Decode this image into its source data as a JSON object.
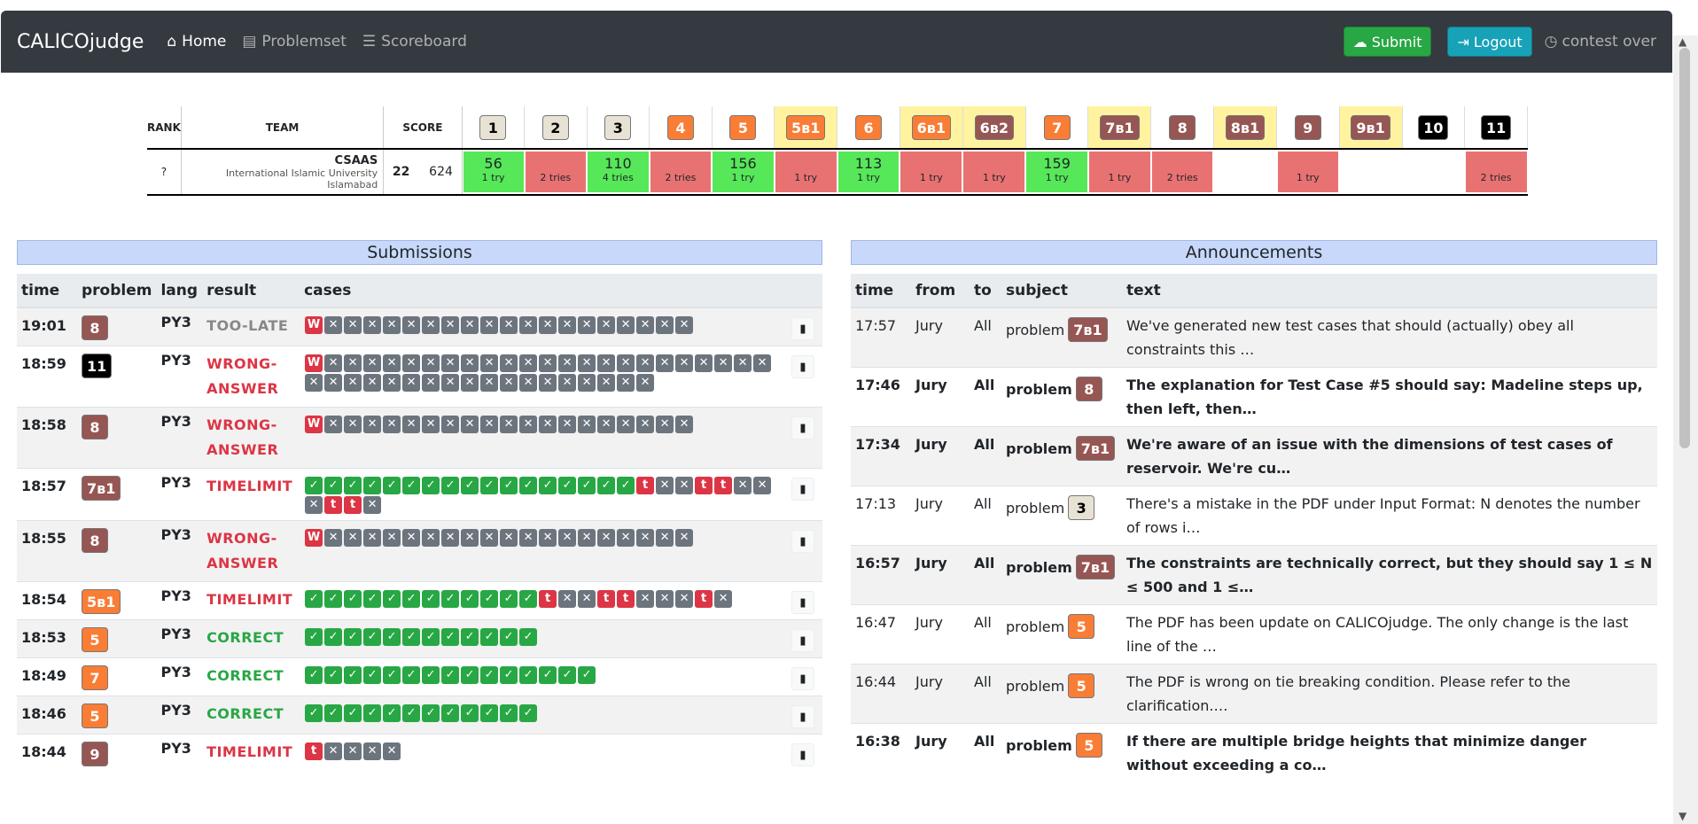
{
  "navbar": {
    "brand": "CALICOjudge",
    "links": [
      {
        "label": "Home",
        "icon": "home-icon",
        "active": true
      },
      {
        "label": "Problemset",
        "icon": "book-icon",
        "active": false
      },
      {
        "label": "Scoreboard",
        "icon": "list-icon",
        "active": false
      }
    ],
    "submit_label": "Submit",
    "logout_label": "Logout",
    "status": "contest over"
  },
  "scoreboard": {
    "headers": {
      "rank": "RANK",
      "team": "TEAM",
      "score": "SCORE"
    },
    "problems": [
      {
        "label": "1",
        "bg": "#e8e2d5",
        "fg": "#000",
        "hl": false
      },
      {
        "label": "2",
        "bg": "#e8e2d5",
        "fg": "#000",
        "hl": false
      },
      {
        "label": "3",
        "bg": "#e8e2d5",
        "fg": "#000",
        "hl": false
      },
      {
        "label": "4",
        "bg": "#f97d35",
        "fg": "#fff",
        "hl": false
      },
      {
        "label": "5",
        "bg": "#f97d35",
        "fg": "#fff",
        "hl": false
      },
      {
        "label": "5в1",
        "bg": "#f97d35",
        "fg": "#fff",
        "hl": true
      },
      {
        "label": "6",
        "bg": "#f97d35",
        "fg": "#fff",
        "hl": false
      },
      {
        "label": "6в1",
        "bg": "#f97d35",
        "fg": "#fff",
        "hl": true
      },
      {
        "label": "6в2",
        "bg": "#965653",
        "fg": "#fff",
        "hl": true
      },
      {
        "label": "7",
        "bg": "#f97d35",
        "fg": "#fff",
        "hl": false
      },
      {
        "label": "7в1",
        "bg": "#965653",
        "fg": "#fff",
        "hl": true
      },
      {
        "label": "8",
        "bg": "#965653",
        "fg": "#fff",
        "hl": false
      },
      {
        "label": "8в1",
        "bg": "#965653",
        "fg": "#fff",
        "hl": true
      },
      {
        "label": "9",
        "bg": "#965653",
        "fg": "#fff",
        "hl": false
      },
      {
        "label": "9в1",
        "bg": "#965653",
        "fg": "#fff",
        "hl": true
      },
      {
        "label": "10",
        "bg": "#000000",
        "fg": "#fff",
        "hl": false
      },
      {
        "label": "11",
        "bg": "#000000",
        "fg": "#fff",
        "hl": false
      }
    ],
    "row": {
      "rank": "?",
      "team_name": "CSAAS",
      "affiliation": "International Islamic University Islamabad",
      "solved": "22",
      "penalty": "624",
      "cells": [
        {
          "status": "solved",
          "time": "56",
          "tries": "1 try"
        },
        {
          "status": "fail",
          "time": "",
          "tries": "2 tries"
        },
        {
          "status": "solved",
          "time": "110",
          "tries": "4 tries"
        },
        {
          "status": "fail",
          "time": "",
          "tries": "2 tries"
        },
        {
          "status": "solved",
          "time": "156",
          "tries": "1 try"
        },
        {
          "status": "fail",
          "time": "",
          "tries": "1 try"
        },
        {
          "status": "solved",
          "time": "113",
          "tries": "1 try"
        },
        {
          "status": "fail",
          "time": "",
          "tries": "1 try"
        },
        {
          "status": "fail",
          "time": "",
          "tries": "1 try"
        },
        {
          "status": "solved",
          "time": "159",
          "tries": "1 try"
        },
        {
          "status": "fail",
          "time": "",
          "tries": "1 try"
        },
        {
          "status": "fail",
          "time": "",
          "tries": "2 tries"
        },
        {
          "status": "empty",
          "time": "",
          "tries": ""
        },
        {
          "status": "fail",
          "time": "",
          "tries": "1 try"
        },
        {
          "status": "empty",
          "time": "",
          "tries": ""
        },
        {
          "status": "empty",
          "time": "",
          "tries": ""
        },
        {
          "status": "fail",
          "time": "",
          "tries": "2 tries"
        }
      ]
    }
  },
  "submissions": {
    "title": "Submissions",
    "headers": [
      "time",
      "problem",
      "lang",
      "result",
      "cases"
    ],
    "rows": [
      {
        "time": "19:01",
        "problem": "8",
        "pbg": "#965653",
        "pfg": "#fff",
        "lang": "PY3",
        "result": "TOO-LATE",
        "rclass": "r-late",
        "cases": "WXXXXXXXXXXXXXXXXXXX"
      },
      {
        "time": "18:59",
        "problem": "11",
        "pbg": "#000000",
        "pfg": "#fff",
        "lang": "PY3",
        "result": "WRONG-ANSWER",
        "rclass": "r-wrong",
        "cases": "WXXXXXXXXXXXXXXXXXXXXXXXXXXXXXXXXXXXXXXXXX"
      },
      {
        "time": "18:58",
        "problem": "8",
        "pbg": "#965653",
        "pfg": "#fff",
        "lang": "PY3",
        "result": "WRONG-ANSWER",
        "rclass": "r-wrong",
        "cases": "WXXXXXXXXXXXXXXXXXXX"
      },
      {
        "time": "18:57",
        "problem": "7в1",
        "pbg": "#965653",
        "pfg": "#fff",
        "lang": "PY3",
        "result": "TIMELIMIT",
        "rclass": "r-time",
        "cases": "VVVVVVVVVVVVVVVVVTXXTTXXXTTX"
      },
      {
        "time": "18:55",
        "problem": "8",
        "pbg": "#965653",
        "pfg": "#fff",
        "lang": "PY3",
        "result": "WRONG-ANSWER",
        "rclass": "r-wrong",
        "cases": "WXXXXXXXXXXXXXXXXXXX"
      },
      {
        "time": "18:54",
        "problem": "5в1",
        "pbg": "#f97d35",
        "pfg": "#fff",
        "lang": "PY3",
        "result": "TIMELIMIT",
        "rclass": "r-time",
        "cases": "VVVVVVVVVVVVTXXTTXXXTX"
      },
      {
        "time": "18:53",
        "problem": "5",
        "pbg": "#f97d35",
        "pfg": "#fff",
        "lang": "PY3",
        "result": "CORRECT",
        "rclass": "r-correct",
        "cases": "VVVVVVVVVVVV"
      },
      {
        "time": "18:49",
        "problem": "7",
        "pbg": "#f97d35",
        "pfg": "#fff",
        "lang": "PY3",
        "result": "CORRECT",
        "rclass": "r-correct",
        "cases": "VVVVVVVVVVVVVVV"
      },
      {
        "time": "18:46",
        "problem": "5",
        "pbg": "#f97d35",
        "pfg": "#fff",
        "lang": "PY3",
        "result": "CORRECT",
        "rclass": "r-correct",
        "cases": "VVVVVVVVVVVV"
      },
      {
        "time": "18:44",
        "problem": "9",
        "pbg": "#965653",
        "pfg": "#fff",
        "lang": "PY3",
        "result": "TIMELIMIT",
        "rclass": "r-time",
        "cases": "TXXXX"
      }
    ]
  },
  "announcements": {
    "title": "Announcements",
    "headers": [
      "time",
      "from",
      "to",
      "subject",
      "text"
    ],
    "rows": [
      {
        "time": "17:57",
        "from": "Jury",
        "to": "All",
        "subject": "problem",
        "problem": "7в1",
        "pbg": "#965653",
        "pfg": "#fff",
        "text": "We've generated new test cases that should (actually) obey all constraints this …",
        "bold": false
      },
      {
        "time": "17:46",
        "from": "Jury",
        "to": "All",
        "subject": "problem",
        "problem": "8",
        "pbg": "#965653",
        "pfg": "#fff",
        "text": "The explanation for Test Case #5 should say: Madeline steps up, then left, then…",
        "bold": true
      },
      {
        "time": "17:34",
        "from": "Jury",
        "to": "All",
        "subject": "problem",
        "problem": "7в1",
        "pbg": "#965653",
        "pfg": "#fff",
        "text": "We're aware of an issue with the dimensions of test cases of reservoir. We're cu…",
        "bold": true
      },
      {
        "time": "17:13",
        "from": "Jury",
        "to": "All",
        "subject": "problem",
        "problem": "3",
        "pbg": "#e8e2d5",
        "pfg": "#000",
        "text": "There's a mistake in the PDF under Input Format: N denotes the number of rows i…",
        "bold": false
      },
      {
        "time": "16:57",
        "from": "Jury",
        "to": "All",
        "subject": "problem",
        "problem": "7в1",
        "pbg": "#965653",
        "pfg": "#fff",
        "text": "The constraints are technically correct, but they should say 1 ≤ N ≤ 500 and 1 ≤…",
        "bold": true
      },
      {
        "time": "16:47",
        "from": "Jury",
        "to": "All",
        "subject": "problem",
        "problem": "5",
        "pbg": "#f97d35",
        "pfg": "#fff",
        "text": "The PDF has been update on CALICOjudge. The only change is the last line of the …",
        "bold": false
      },
      {
        "time": "16:44",
        "from": "Jury",
        "to": "All",
        "subject": "problem",
        "problem": "5",
        "pbg": "#f97d35",
        "pfg": "#fff",
        "text": "The PDF is wrong on tie breaking condition. Please refer to the clarification.…",
        "bold": false
      },
      {
        "time": "16:38",
        "from": "Jury",
        "to": "All",
        "subject": "problem",
        "problem": "5",
        "pbg": "#f97d35",
        "pfg": "#fff",
        "text": "If there are multiple bridge heights that minimize danger without exceeding a co…",
        "bold": true
      }
    ]
  }
}
